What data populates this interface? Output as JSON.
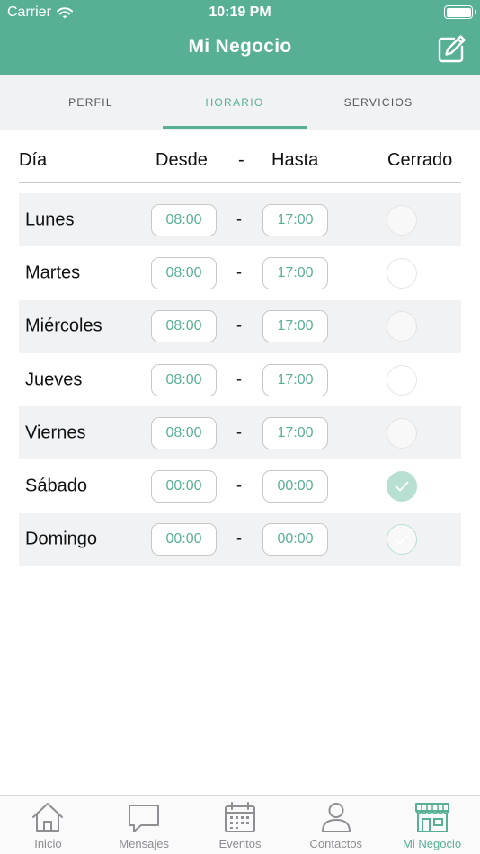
{
  "status": {
    "carrier": "Carrier",
    "time": "10:19 PM"
  },
  "header": {
    "title": "Mi Negocio",
    "edit_icon": "edit-icon"
  },
  "tabs": [
    {
      "label": "PERFIL",
      "active": false
    },
    {
      "label": "HORARIO",
      "active": true
    },
    {
      "label": "SERVICIOS",
      "active": false
    }
  ],
  "schedule": {
    "columns": {
      "day": "Día",
      "from": "Desde",
      "sep": "-",
      "to": "Hasta",
      "closed": "Cerrado"
    },
    "rows": [
      {
        "day": "Lunes",
        "from": "08:00",
        "to": "17:00",
        "closed": false
      },
      {
        "day": "Martes",
        "from": "08:00",
        "to": "17:00",
        "closed": false
      },
      {
        "day": "Miércoles",
        "from": "08:00",
        "to": "17:00",
        "closed": false
      },
      {
        "day": "Jueves",
        "from": "08:00",
        "to": "17:00",
        "closed": false
      },
      {
        "day": "Viernes",
        "from": "08:00",
        "to": "17:00",
        "closed": false
      },
      {
        "day": "Sábado",
        "from": "00:00",
        "to": "00:00",
        "closed": true
      },
      {
        "day": "Domingo",
        "from": "00:00",
        "to": "00:00",
        "closed": true
      }
    ]
  },
  "tabbar": {
    "items": [
      {
        "label": "Inicio",
        "icon": "home-icon",
        "active": false
      },
      {
        "label": "Mensajes",
        "icon": "message-icon",
        "active": false
      },
      {
        "label": "Eventos",
        "icon": "calendar-icon",
        "active": false
      },
      {
        "label": "Contactos",
        "icon": "person-icon",
        "active": false
      },
      {
        "label": "Mi Negocio",
        "icon": "store-icon",
        "active": true
      }
    ]
  },
  "colors": {
    "accent": "#57b095",
    "checked": "#b7e0d3",
    "shaded_row": "#f1f2f4",
    "inactive": "#8e8e93"
  }
}
